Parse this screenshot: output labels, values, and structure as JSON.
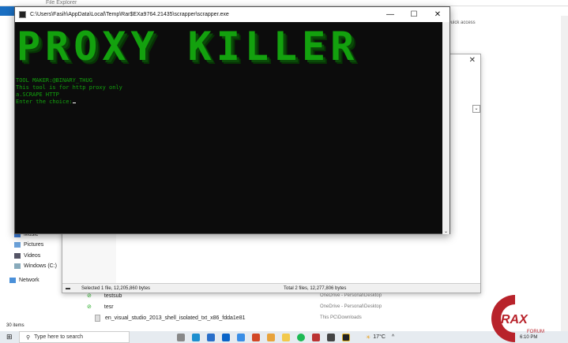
{
  "explorer": {
    "title": "File Explorer",
    "quick_access": "Quick access",
    "nav": [
      "Music",
      "Pictures",
      "Videos",
      "Windows (C:)",
      "Network"
    ],
    "files": [
      {
        "name": "testsub",
        "location": "OneDrive - Personal\\Desktop"
      },
      {
        "name": "tesr",
        "location": "OneDrive - Personal\\Desktop"
      },
      {
        "name": "en_visual_studio_2013_shell_isolated_txt_x86_fdda1e81",
        "location": "This PC\\Downloads"
      }
    ],
    "item_count": "30 items"
  },
  "dialog": {
    "status_selected": "Selected 1 file, 12,205,860 bytes",
    "status_total": "Total 2 files, 12,277,806 bytes"
  },
  "console": {
    "title": "C:\\Users\\Fasih\\AppData\\Local\\Temp\\Rar$EXa9764.21435\\scrapper\\scrapper.exe",
    "banner": "PROXY KILLER",
    "lines": [
      "TOOL MAKER:@BINARY_THUG",
      "This tool is for http proxy only",
      "a.SCRAPE HTTP",
      "Enter the choice:"
    ]
  },
  "taskbar": {
    "search_placeholder": "Type here to search",
    "weather": "17°C",
    "time": "6:10 PM"
  },
  "watermark": {
    "text": "CRAX",
    "sub": "FORUM"
  }
}
